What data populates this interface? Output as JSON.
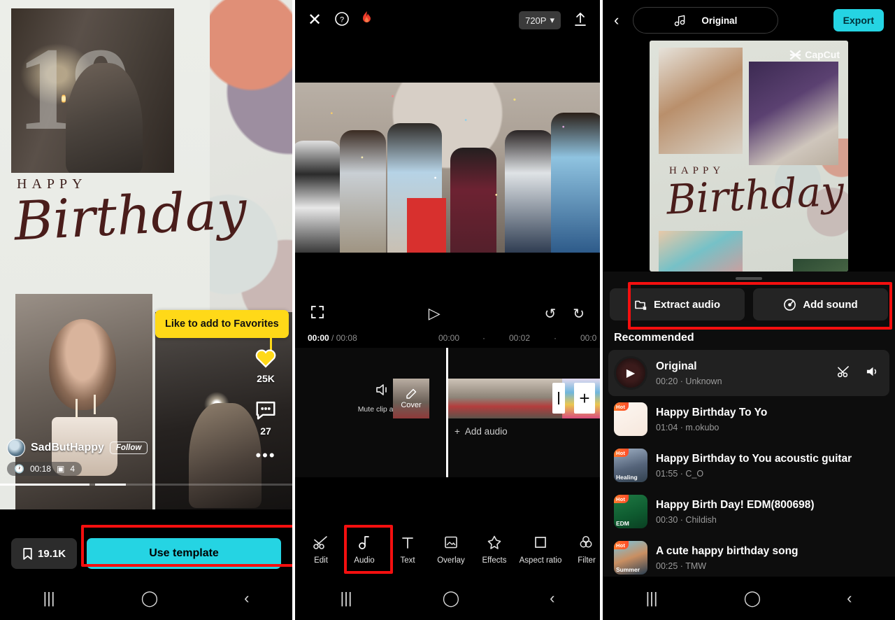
{
  "panel1": {
    "back_icon": "chevron-left-icon",
    "card": {
      "happy": "HAPPY",
      "birthday": "Birthday",
      "age": "19"
    },
    "tooltip": "Like to add to Favorites",
    "likes": "25K",
    "comments": "27",
    "more_icon": "ellipsis-icon",
    "author": "SadButHappy",
    "follow": "Follow",
    "duration": "00:18",
    "clips": "4",
    "saves": "19.1K",
    "use_template": "Use template",
    "nav": {
      "recents": "|||",
      "home": "O",
      "back": "<"
    }
  },
  "panel2": {
    "topbar": {
      "close_icon": "close-icon",
      "help_icon": "question-mark-icon",
      "flame_icon": "flame-icon",
      "resolution": "720P",
      "export_icon": "upload-icon"
    },
    "controls": {
      "fullscreen_icon": "expand-icon",
      "play_icon": "play-icon",
      "undo_icon": "undo-icon",
      "redo_icon": "redo-icon"
    },
    "timeline": {
      "current_time": "00:00",
      "total_time": "/ 00:08",
      "ticks": [
        "00:00",
        "·",
        "00:02",
        "·",
        "00:0"
      ],
      "mute_clip_audio": "Mute clip audio",
      "cover": "Cover",
      "add_audio": "Add audio",
      "add_clip_icon": "plus-icon"
    },
    "tools": [
      {
        "label": "Edit",
        "icon": "scissors-icon"
      },
      {
        "label": "Audio",
        "icon": "music-note-icon"
      },
      {
        "label": "Text",
        "icon": "text-t-icon"
      },
      {
        "label": "Overlay",
        "icon": "picture-frame-icon"
      },
      {
        "label": "Effects",
        "icon": "sparkle-star-icon"
      },
      {
        "label": "Aspect ratio",
        "icon": "square-icon"
      },
      {
        "label": "Filter",
        "icon": "three-circles-icon"
      }
    ],
    "nav": {
      "recents": "|||",
      "home": "O",
      "back": "<"
    }
  },
  "panel3": {
    "topbar": {
      "back_icon": "chevron-left-icon",
      "music_icon": "music-notes-icon",
      "track_name": "Original",
      "export": "Export"
    },
    "preview": {
      "watermark": "CapCut",
      "happy": "HAPPY",
      "birthday": "Birthday"
    },
    "actions": [
      {
        "label": "Extract audio",
        "icon": "extract-folder-icon"
      },
      {
        "label": "Add sound",
        "icon": "disc-icon"
      }
    ],
    "section_title": "Recommended",
    "tracks": [
      {
        "title": "Original",
        "duration": "00:20",
        "artist": "Unknown",
        "selected": true,
        "thumb": "play-circle",
        "badge": "",
        "thumb_label": "",
        "icons": [
          "scissors-icon",
          "volume-icon"
        ]
      },
      {
        "title": "Happy Birthday To Yo",
        "duration": "01:04",
        "artist": "m.okubo",
        "selected": false,
        "thumb": "floral",
        "badge": "Hot",
        "thumb_label": ""
      },
      {
        "title": "Happy Birthday to You acoustic guitar",
        "duration": "01:55",
        "artist": "C_O",
        "selected": false,
        "thumb": "mountain",
        "badge": "Hot",
        "thumb_label": "Healing"
      },
      {
        "title": "Happy Birth Day! EDM(800698)",
        "duration": "00:30",
        "artist": "Childish",
        "selected": false,
        "thumb": "green",
        "badge": "Hot",
        "thumb_label": "EDM"
      },
      {
        "title": "A cute happy birthday song",
        "duration": "00:25",
        "artist": "TMW",
        "selected": false,
        "thumb": "beach",
        "badge": "Hot",
        "thumb_label": "Summer"
      }
    ],
    "nav": {
      "recents": "|||",
      "home": "O",
      "back": "<"
    }
  },
  "colors": {
    "highlight": "#f40f0f",
    "accent_cyan": "#25d4e3",
    "tooltip_yellow": "#ffd918"
  }
}
